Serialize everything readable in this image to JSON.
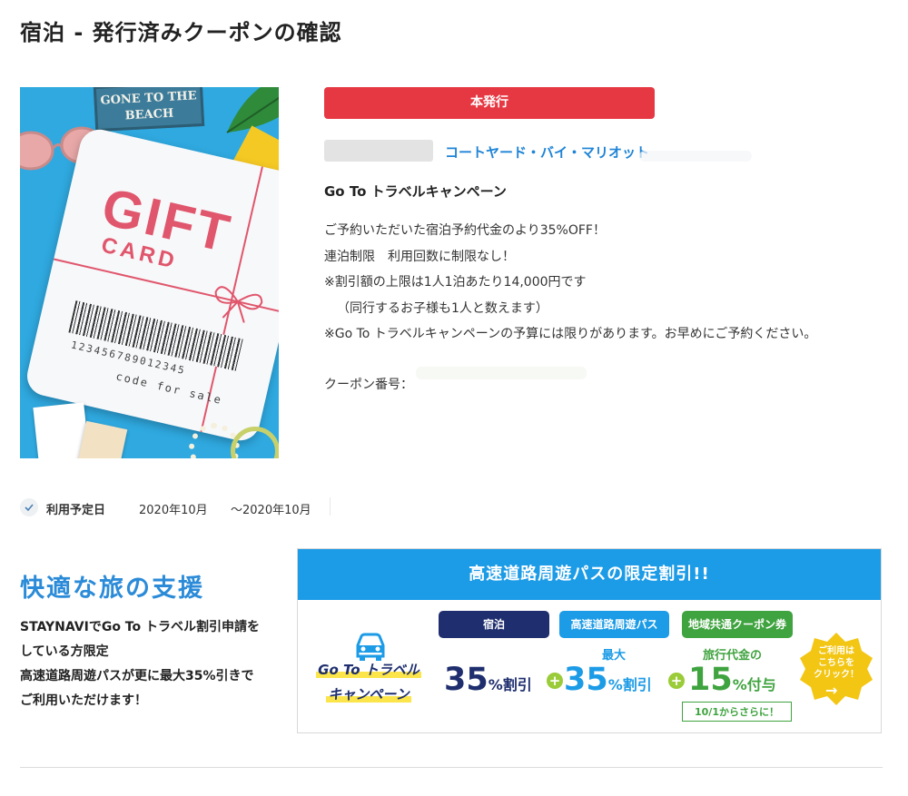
{
  "page": {
    "title": "宿泊 - 発行済みクーポンの確認"
  },
  "gift_image": {
    "sign_line1": "GONE TO THE",
    "sign_line2": "BEACH",
    "card_title": "GIFT",
    "card_sub": "CARD",
    "barcode_number": "123456789012345",
    "card_footer": "code for sale"
  },
  "coupon": {
    "status_label": "本発行",
    "hotel_name": "コートヤード・バイ・マリオット",
    "campaign_title": "Go To トラベルキャンペーン",
    "description_lines": [
      "ご予約いただいた宿泊予約代金のより35%OFF！",
      "連泊制限　利用回数に制限なし！",
      "※割引額の上限は1人1泊あたり14,000円です",
      "（同行するお子様も1人と数えます）",
      "※Go To トラベルキャンペーンの予算には限りがあります。お早めにご予約ください。"
    ],
    "coupon_number_label": "クーポン番号："
  },
  "schedule": {
    "label": "利用予定日",
    "from": "2020年10月",
    "to": "〜2020年10月"
  },
  "support": {
    "title": "快適な旅の支援",
    "text_lines": [
      "STAYNAVIでGo To トラベル割引申請を",
      "している方限定",
      "高速道路周遊パスが更に最大35%引きで",
      "ご利用いただけます！"
    ]
  },
  "banner": {
    "header": "高速道路周遊パスの限定割引!!",
    "goto_line1": "Go To トラベル",
    "goto_line2": "キャンペーン",
    "pill_1": "宿泊",
    "pill_2": "高速道路周遊パス",
    "pill_3": "地域共通クーポン券",
    "value_1": "35",
    "unit_1": "%割引",
    "cap_2": "最大",
    "value_2": "35",
    "unit_2": "%割引",
    "cap_3": "旅行代金の",
    "value_3": "15",
    "unit_3": "%付与",
    "note": "10/1からさらに！",
    "badge_line1": "ご利用は",
    "badge_line2": "こちらを",
    "badge_line3": "クリック！",
    "badge_arrow": "→",
    "plus_symbol": "+"
  },
  "colors": {
    "issue_red": "#e63843",
    "link_blue": "#1f84d6",
    "banner_blue": "#1c9be6",
    "navy": "#1e2e6e",
    "green": "#3fa33f",
    "badge_yellow": "#f3c613"
  }
}
